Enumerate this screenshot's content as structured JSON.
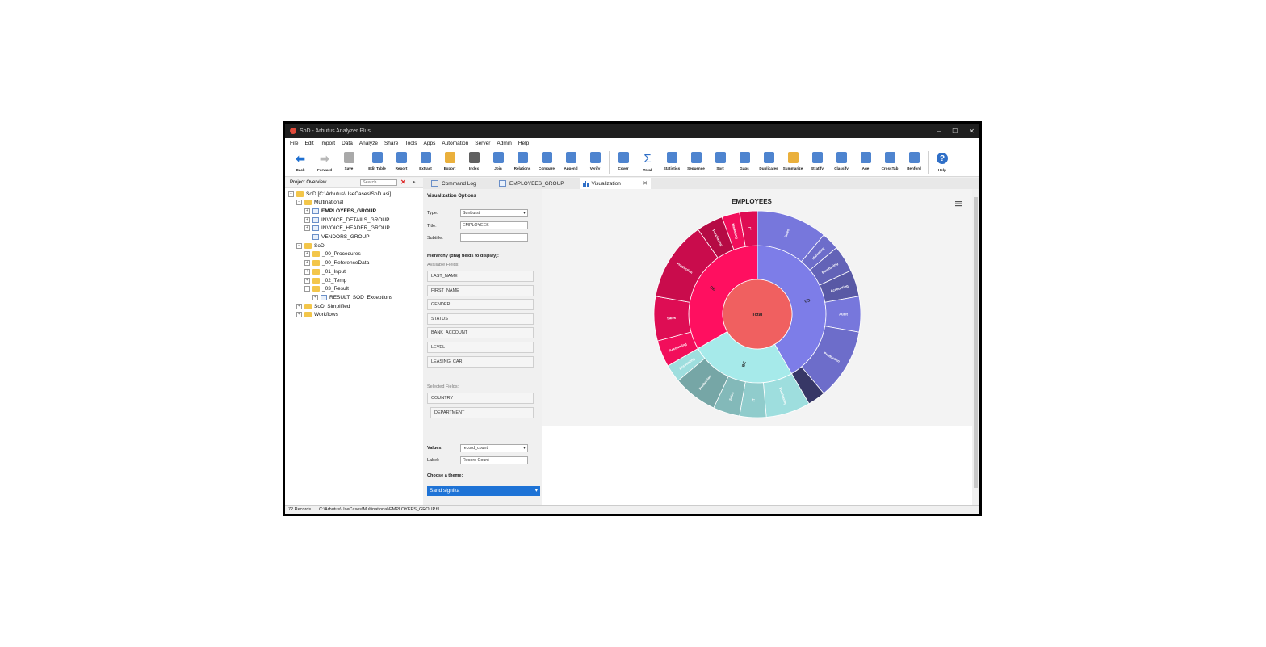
{
  "window": {
    "title": "SoD - Arbutus Analyzer Plus",
    "controls": [
      "–",
      "☐",
      "✕"
    ]
  },
  "menu": [
    "File",
    "Edit",
    "Import",
    "Data",
    "Analyze",
    "Share",
    "Tools",
    "Apps",
    "Automation",
    "Server",
    "Admin",
    "Help"
  ],
  "toolbar": [
    {
      "label": "Back",
      "icon": "back-arrow-icon",
      "color": "#1e6fd0"
    },
    {
      "label": "Forward",
      "icon": "forward-arrow-icon",
      "color": "#b8b8b8"
    },
    {
      "label": "Save",
      "icon": "save-icon",
      "color": "#9a9a9a"
    },
    {
      "label": "Edit Table",
      "icon": "edit-table-icon",
      "color": "#2f6fc7"
    },
    {
      "label": "Report",
      "icon": "report-icon",
      "color": "#2f6fc7"
    },
    {
      "label": "Extract",
      "icon": "extract-icon",
      "color": "#2f6fc7"
    },
    {
      "label": "Export",
      "icon": "export-icon",
      "color": "#e6a21a"
    },
    {
      "label": "Index",
      "icon": "index-icon",
      "color": "#444"
    },
    {
      "label": "Join",
      "icon": "join-icon",
      "color": "#2f6fc7"
    },
    {
      "label": "Relations",
      "icon": "relations-icon",
      "color": "#2f6fc7"
    },
    {
      "label": "Compare",
      "icon": "compare-icon",
      "color": "#2f6fc7"
    },
    {
      "label": "Append",
      "icon": "append-icon",
      "color": "#2f6fc7"
    },
    {
      "label": "Verify",
      "icon": "verify-icon",
      "color": "#2f6fc7"
    },
    {
      "label": "Cover",
      "icon": "cover-icon",
      "color": "#2f6fc7"
    },
    {
      "label": "Total",
      "icon": "sigma-icon",
      "color": "#2f6fc7"
    },
    {
      "label": "Statistics",
      "icon": "statistics-icon",
      "color": "#2f6fc7"
    },
    {
      "label": "Sequence",
      "icon": "sequence-icon",
      "color": "#2f6fc7"
    },
    {
      "label": "Sort",
      "icon": "sort-icon",
      "color": "#2f6fc7"
    },
    {
      "label": "Gaps",
      "icon": "gaps-icon",
      "color": "#2f6fc7"
    },
    {
      "label": "Duplicates",
      "icon": "duplicates-icon",
      "color": "#2f6fc7"
    },
    {
      "label": "Summarize",
      "icon": "summarize-icon",
      "color": "#e6a21a"
    },
    {
      "label": "Stratify",
      "icon": "stratify-icon",
      "color": "#2f6fc7"
    },
    {
      "label": "Classify",
      "icon": "classify-icon",
      "color": "#2f6fc7"
    },
    {
      "label": "Age",
      "icon": "age-icon",
      "color": "#2f6fc7"
    },
    {
      "label": "CrossTab",
      "icon": "crosstab-icon",
      "color": "#2f6fc7"
    },
    {
      "label": "Benford",
      "icon": "benford-icon",
      "color": "#2f6fc7"
    },
    {
      "label": "Help",
      "icon": "help-icon",
      "color": "#2f6fc7"
    }
  ],
  "project_panel": {
    "title": "Project Overview",
    "search_placeholder": "Search",
    "tree": [
      {
        "label": "SoD [C:\\Arbutus\\UseCases\\SoD.asi]",
        "level": 0,
        "type": "folder",
        "exp": "−"
      },
      {
        "label": "Multinational",
        "level": 1,
        "type": "folder",
        "exp": "−"
      },
      {
        "label": "EMPLOYEES_GROUP",
        "level": 2,
        "type": "table",
        "exp": "+",
        "bold": true
      },
      {
        "label": "INVOICE_DETAILS_GROUP",
        "level": 2,
        "type": "table",
        "exp": "+"
      },
      {
        "label": "INVOICE_HEADER_GROUP",
        "level": 2,
        "type": "table",
        "exp": "+"
      },
      {
        "label": "VENDORS_GROUP",
        "level": 2,
        "type": "table",
        "exp": ""
      },
      {
        "label": "SoD",
        "level": 1,
        "type": "folder",
        "exp": "−"
      },
      {
        "label": "_00_Procedures",
        "level": 2,
        "type": "folder",
        "exp": "+"
      },
      {
        "label": "_00_ReferenceData",
        "level": 2,
        "type": "folder",
        "exp": "+"
      },
      {
        "label": "_01_Input",
        "level": 2,
        "type": "folder",
        "exp": "+"
      },
      {
        "label": "_02_Temp",
        "level": 2,
        "type": "folder",
        "exp": "+"
      },
      {
        "label": "_03_Result",
        "level": 2,
        "type": "folder",
        "exp": "−"
      },
      {
        "label": "RESULT_SOD_Exceptions",
        "level": 3,
        "type": "table",
        "exp": "+"
      },
      {
        "label": "SoD_Simplified",
        "level": 1,
        "type": "folder",
        "exp": "+"
      },
      {
        "label": "Workflows",
        "level": 1,
        "type": "folder",
        "exp": "+"
      }
    ]
  },
  "tabs": [
    {
      "label": "Command Log",
      "icon": "command-log-icon"
    },
    {
      "label": "EMPLOYEES_GROUP",
      "icon": "table-icon"
    },
    {
      "label": "Visualization",
      "icon": "chart-icon",
      "active": true
    }
  ],
  "options": {
    "heading": "Visualization Options",
    "type_label": "Type:",
    "type_value": "Sunburst",
    "title_label": "Title:",
    "title_value": "EMPLOYEES",
    "subtitle_label": "Subtitle:",
    "subtitle_value": "",
    "hierarchy_heading": "Hierarchy (drag fields to display):",
    "available_label": "Available Fields:",
    "available_fields": [
      "LAST_NAME",
      "FIRST_NAME",
      "GENDER",
      "STATUS",
      "BANK_ACCOUNT",
      "LEVEL",
      "LEASING_CAR"
    ],
    "selected_label": "Selected Fields:",
    "selected_fields": [
      "COUNTRY",
      "DEPARTMENT"
    ],
    "values_label": "Values:",
    "values_value": "record_count",
    "label_label": "Label:",
    "label_value": "Record Count",
    "theme_label": "Choose a theme:",
    "theme_value": "Sand signika"
  },
  "chart_data": {
    "type": "sunburst",
    "title": "EMPLOYEES",
    "center_label": "Total",
    "levels": [
      "COUNTRY",
      "DEPARTMENT"
    ],
    "children": [
      {
        "name": "US",
        "value": 30,
        "color": "#7d7de8",
        "children": [
          {
            "name": "Sales",
            "value": 8
          },
          {
            "name": "Marketing",
            "value": 2
          },
          {
            "name": "Purchasing",
            "value": 3
          },
          {
            "name": "Accounting",
            "value": 3
          },
          {
            "name": "Audit",
            "value": 4
          },
          {
            "name": "Production",
            "value": 8
          },
          {
            "name": "",
            "value": 2
          }
        ]
      },
      {
        "name": "BE",
        "value": 18,
        "color": "#a6eaea",
        "children": [
          {
            "name": "Purchasing",
            "value": 5
          },
          {
            "name": "IT",
            "value": 3
          },
          {
            "name": "Sales",
            "value": 3
          },
          {
            "name": "Production",
            "value": 5
          },
          {
            "name": "Accounting",
            "value": 2
          }
        ]
      },
      {
        "name": "DE",
        "value": 24,
        "color": "#ff0f60",
        "children": [
          {
            "name": "Accounting",
            "value": 3
          },
          {
            "name": "Sales",
            "value": 5
          },
          {
            "name": "Production",
            "value": 9
          },
          {
            "name": "Purchasing",
            "value": 3
          },
          {
            "name": "Marketing",
            "value": 2
          },
          {
            "name": "IT",
            "value": 2
          }
        ]
      }
    ]
  },
  "status": {
    "records": "72 Records",
    "path": "C:\\Arbutus\\UseCases\\Multinational\\EMPLOYEES_GROUP.fil"
  }
}
